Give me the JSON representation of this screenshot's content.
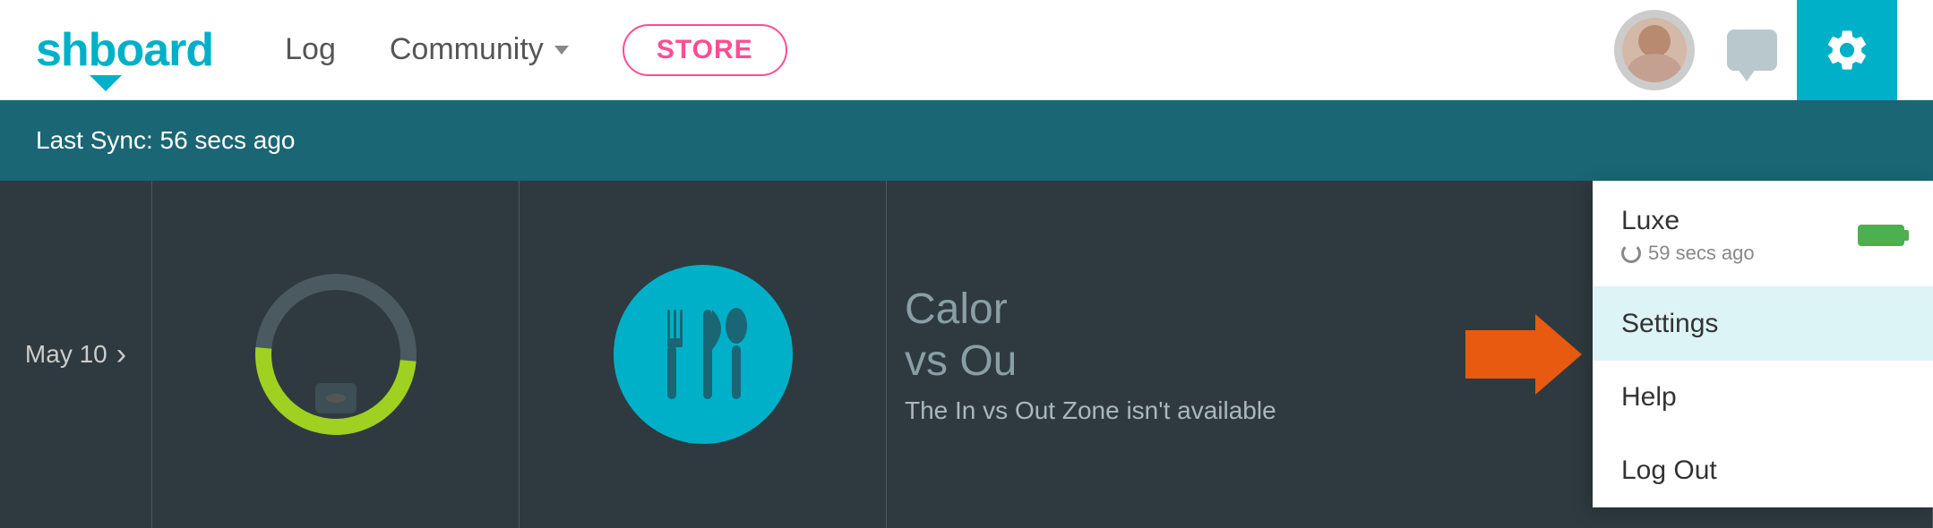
{
  "header": {
    "brand": "shboard",
    "brand_color": "#00b0c8",
    "nav_items": [
      {
        "label": "Log",
        "has_dropdown": false
      },
      {
        "label": "Community",
        "has_dropdown": true
      }
    ],
    "store_label": "STORE",
    "gear_bg": "#00b0c8"
  },
  "band": {
    "sync_label": "Last Sync: 56 secs ago"
  },
  "cards": [
    {
      "id": "date",
      "date": "May 10",
      "arrow": "›"
    },
    {
      "id": "gauge",
      "label": ""
    },
    {
      "id": "food",
      "label": ""
    },
    {
      "id": "calorie",
      "title_line1": "Calor",
      "title_line2": "vs Ou",
      "subtitle": "The In vs Out Zone isn't available"
    }
  ],
  "dropdown": {
    "device_name": "Luxe",
    "sync_time": "59 secs ago",
    "menu_items": [
      {
        "label": "Settings",
        "active": true
      },
      {
        "label": "Help",
        "active": false
      },
      {
        "label": "Log Out",
        "active": false
      }
    ]
  },
  "arrow": {
    "color": "#e85a10"
  }
}
